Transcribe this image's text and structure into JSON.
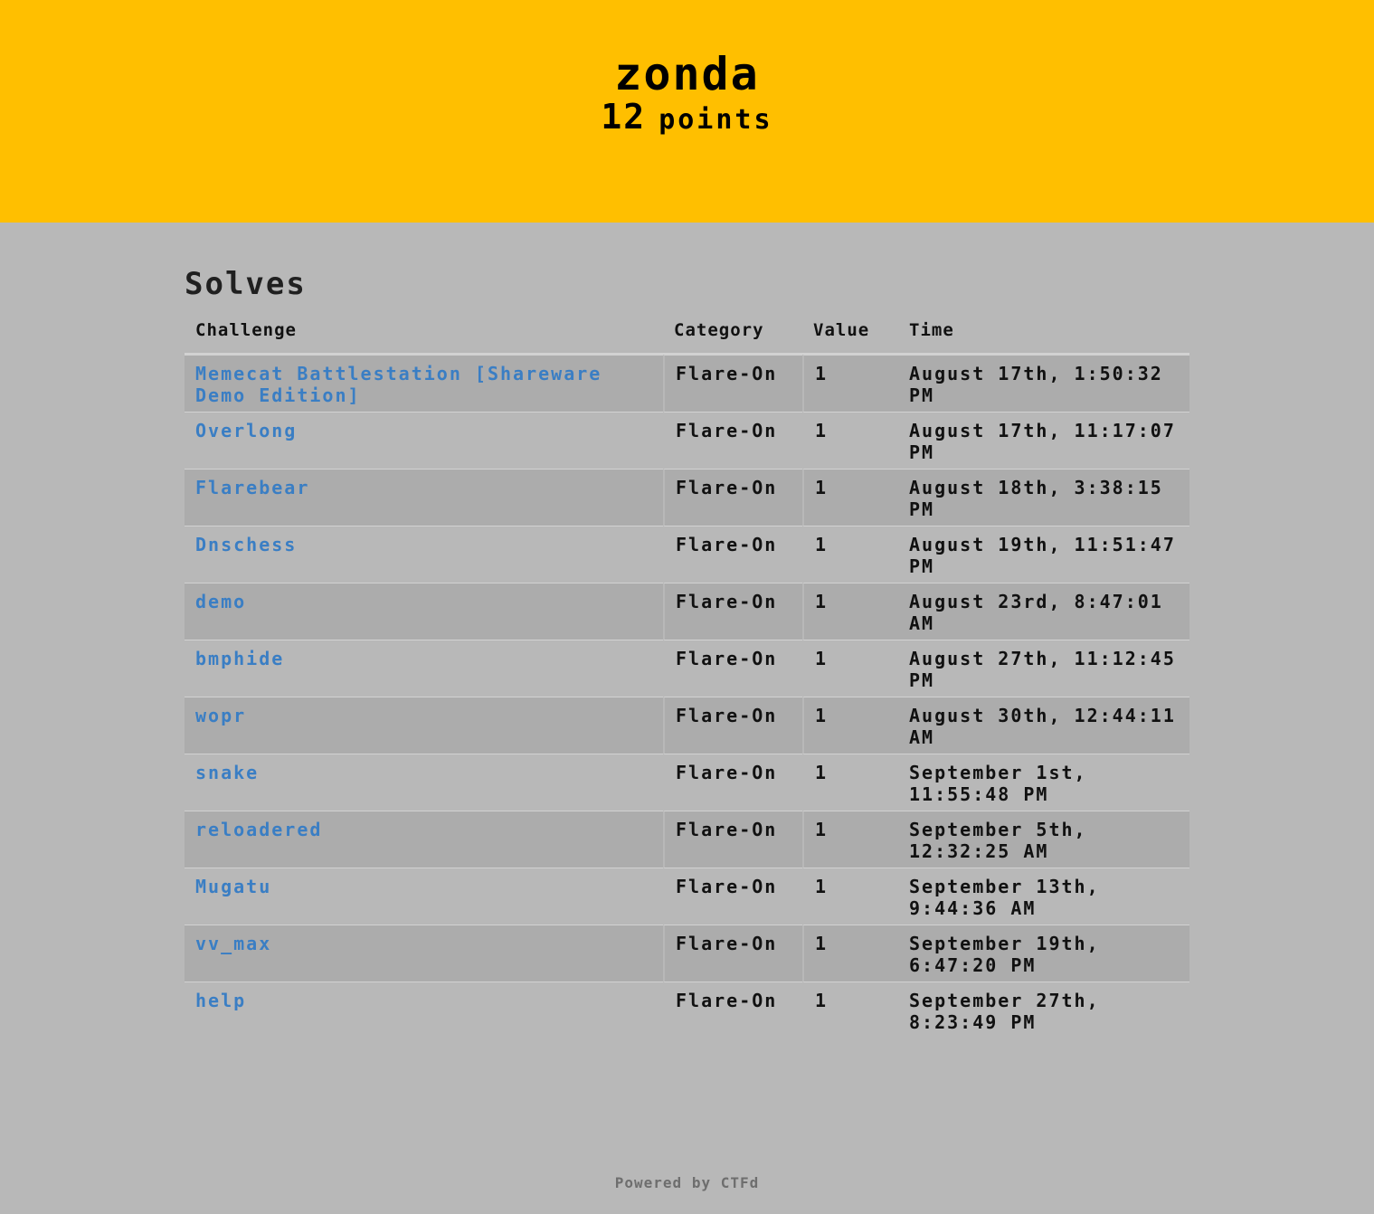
{
  "team": {
    "name": "zonda",
    "points_value": "12",
    "points_unit": "points"
  },
  "solves": {
    "title": "Solves",
    "columns": [
      "Challenge",
      "Category",
      "Value",
      "Time"
    ],
    "rows": [
      {
        "challenge": "Memecat Battlestation [Shareware Demo Edition]",
        "category": "Flare-On",
        "value": "1",
        "time": "August 17th, 1:50:32 PM"
      },
      {
        "challenge": "Overlong",
        "category": "Flare-On",
        "value": "1",
        "time": "August 17th, 11:17:07 PM"
      },
      {
        "challenge": "Flarebear",
        "category": "Flare-On",
        "value": "1",
        "time": "August 18th, 3:38:15 PM"
      },
      {
        "challenge": "Dnschess",
        "category": "Flare-On",
        "value": "1",
        "time": "August 19th, 11:51:47 PM"
      },
      {
        "challenge": "demo",
        "category": "Flare-On",
        "value": "1",
        "time": "August 23rd, 8:47:01 AM"
      },
      {
        "challenge": "bmphide",
        "category": "Flare-On",
        "value": "1",
        "time": "August 27th, 11:12:45 PM"
      },
      {
        "challenge": "wopr",
        "category": "Flare-On",
        "value": "1",
        "time": "August 30th, 12:44:11 AM"
      },
      {
        "challenge": "snake",
        "category": "Flare-On",
        "value": "1",
        "time": "September 1st, 11:55:48 PM"
      },
      {
        "challenge": "reloadered",
        "category": "Flare-On",
        "value": "1",
        "time": "September 5th, 12:32:25 AM"
      },
      {
        "challenge": "Mugatu",
        "category": "Flare-On",
        "value": "1",
        "time": "September 13th, 9:44:36 AM"
      },
      {
        "challenge": "vv_max",
        "category": "Flare-On",
        "value": "1",
        "time": "September 19th, 6:47:20 PM"
      },
      {
        "challenge": "help",
        "category": "Flare-On",
        "value": "1",
        "time": "September 27th, 8:23:49 PM"
      }
    ]
  },
  "footer": {
    "text": "Powered by CTFd"
  },
  "colors": {
    "header_bg": "#ffbf00",
    "page_bg": "#b8b8b8",
    "stripe_bg": "#acacac",
    "link": "#3a7ec4"
  }
}
